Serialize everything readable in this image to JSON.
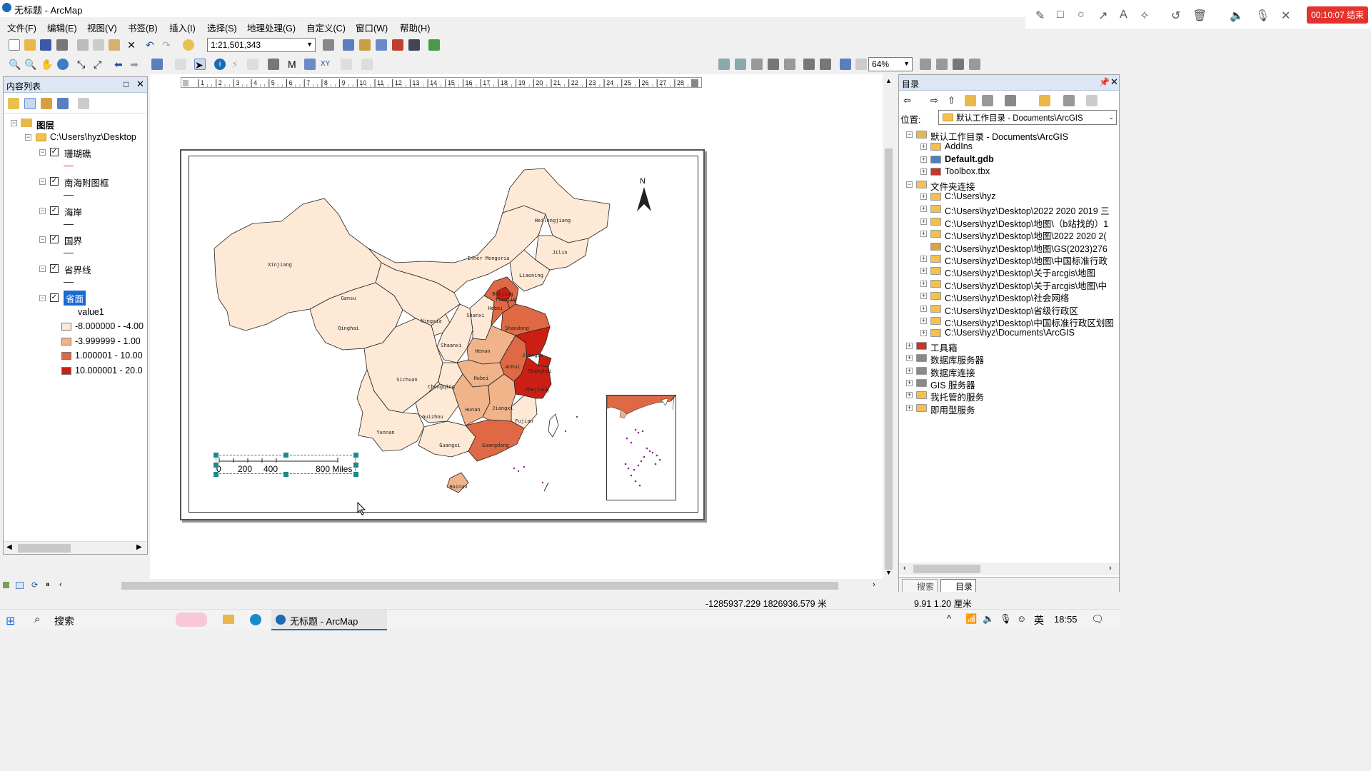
{
  "window": {
    "title": "无标题 - ArcMap"
  },
  "recorder": {
    "timer": "00:10:07 结束"
  },
  "menu": [
    "文件(F)",
    "编辑(E)",
    "视图(V)",
    "书签(B)",
    "插入(I)",
    "选择(S)",
    "地理处理(G)",
    "自定义(C)",
    "窗口(W)",
    "帮助(H)"
  ],
  "toolbar": {
    "scale": "1:21,501,343",
    "zoom": "64%"
  },
  "ruler": {
    "ticks": [
      "1",
      "2",
      "3",
      "4",
      "5",
      "6",
      "7",
      "8",
      "9",
      "10",
      "11",
      "12",
      "13",
      "14",
      "15",
      "16",
      "17",
      "18",
      "19",
      "20",
      "21",
      "22",
      "23",
      "24",
      "25",
      "26",
      "27",
      "28"
    ]
  },
  "toc": {
    "title": "内容列表",
    "root": "图层",
    "path": "C:\\Users\\hyz\\Desktop",
    "layers": [
      "珊瑚礁",
      "南海附图框",
      "海岸",
      "国界",
      "省界线",
      "省面"
    ],
    "field": "value1",
    "legend": [
      {
        "label": "-8.000000 - -4.00",
        "color": "#fde9d6"
      },
      {
        "label": "-3.999999 - 1.00",
        "color": "#f0b38a"
      },
      {
        "label": "1.000001 - 10.00",
        "color": "#de6944"
      },
      {
        "label": "10.000001 - 20.0",
        "color": "#cc1f14"
      }
    ]
  },
  "map": {
    "north": "N",
    "scalebar": {
      "labels": [
        "0",
        "200",
        "400",
        "800 Miles"
      ]
    },
    "provinces": [
      {
        "name": "Xinjiang",
        "value": -6,
        "color": "#fde9d6"
      },
      {
        "name": "Qinghai",
        "value": -6,
        "color": "#fde9d6"
      },
      {
        "name": "Gansu",
        "value": -6,
        "color": "#fde9d6"
      },
      {
        "name": "Inner Mongoria",
        "value": -6,
        "color": "#fde9d6"
      },
      {
        "name": "Heilongjiang",
        "value": -6,
        "color": "#fde9d6"
      },
      {
        "name": "Jilin",
        "value": -6,
        "color": "#fde9d6"
      },
      {
        "name": "Liaoning",
        "value": -6,
        "color": "#fde9d6"
      },
      {
        "name": "Ningxia",
        "value": -6,
        "color": "#fde9d6"
      },
      {
        "name": "Shaanxi",
        "value": -6,
        "color": "#fde9d6"
      },
      {
        "name": "Shanxi",
        "value": -6,
        "color": "#fde9d6"
      },
      {
        "name": "Sichuan",
        "value": -6,
        "color": "#fde9d6"
      },
      {
        "name": "Chongqing",
        "value": -6,
        "color": "#fde9d6"
      },
      {
        "name": "Guizhou",
        "value": -6,
        "color": "#fde9d6"
      },
      {
        "name": "Yunnan",
        "value": -6,
        "color": "#fde9d6"
      },
      {
        "name": "Guangxi",
        "value": -6,
        "color": "#fde9d6"
      },
      {
        "name": "Hainan",
        "value": -1,
        "color": "#f0b38a"
      },
      {
        "name": "Fujian",
        "value": -6,
        "color": "#fde9d6"
      },
      {
        "name": "Hebei",
        "value": 5,
        "color": "#de6944"
      },
      {
        "name": "Beijing",
        "value": 15,
        "color": "#cc1f14"
      },
      {
        "name": "Tianjin",
        "value": 5,
        "color": "#de6944"
      },
      {
        "name": "Shandong",
        "value": 5,
        "color": "#de6944"
      },
      {
        "name": "Henan",
        "value": -1,
        "color": "#f0b38a"
      },
      {
        "name": "Hubei",
        "value": -1,
        "color": "#f0b38a"
      },
      {
        "name": "Hunan",
        "value": -1,
        "color": "#f0b38a"
      },
      {
        "name": "Jiangxi",
        "value": -1,
        "color": "#f0b38a"
      },
      {
        "name": "Anhui",
        "value": 5,
        "color": "#de6944"
      },
      {
        "name": "Jiangsu",
        "value": 15,
        "color": "#cc1f14"
      },
      {
        "name": "Shanghai",
        "value": 15,
        "color": "#cc1f14"
      },
      {
        "name": "Zhejiang",
        "value": 15,
        "color": "#cc1f14"
      },
      {
        "name": "Guangdong",
        "value": 5,
        "color": "#de6944"
      }
    ]
  },
  "catalog": {
    "title": "目录",
    "location_label": "位置:",
    "location_value": "默认工作目录 - Documents\\ArcGIS",
    "items": [
      "默认工作目录 - Documents\\ArcGIS",
      "AddIns",
      "Default.gdb",
      "Toolbox.tbx",
      "文件夹连接",
      "C:\\Users\\hyz",
      "C:\\Users\\hyz\\Desktop\\2022 2020 2019 三",
      "C:\\Users\\hyz\\Desktop\\地图\\（b站找的）1",
      "C:\\Users\\hyz\\Desktop\\地图\\2022 2020 2(",
      "C:\\Users\\hyz\\Desktop\\地图\\GS(2023)276",
      "C:\\Users\\hyz\\Desktop\\地图\\中国标准行政",
      "C:\\Users\\hyz\\Desktop\\关于arcgis\\地图",
      "C:\\Users\\hyz\\Desktop\\关于arcgis\\地图\\中",
      "C:\\Users\\hyz\\Desktop\\社会网络",
      "C:\\Users\\hyz\\Desktop\\省级行政区",
      "C:\\Users\\hyz\\Desktop\\中国标准行政区划图",
      "C:\\Users\\hyz\\Documents\\ArcGIS",
      "工具箱",
      "数据库服务器",
      "数据库连接",
      "GIS 服务器",
      "我托管的服务",
      "即用型服务"
    ],
    "tabs": [
      "搜索",
      "目录"
    ]
  },
  "status": {
    "coords": "-1285937.229  1826936.579 米",
    "page": "9.91  1.20 厘米"
  },
  "taskbar": {
    "search": "搜索",
    "app": "无标题 - ArcMap",
    "ime": "英",
    "time": "18:55"
  }
}
